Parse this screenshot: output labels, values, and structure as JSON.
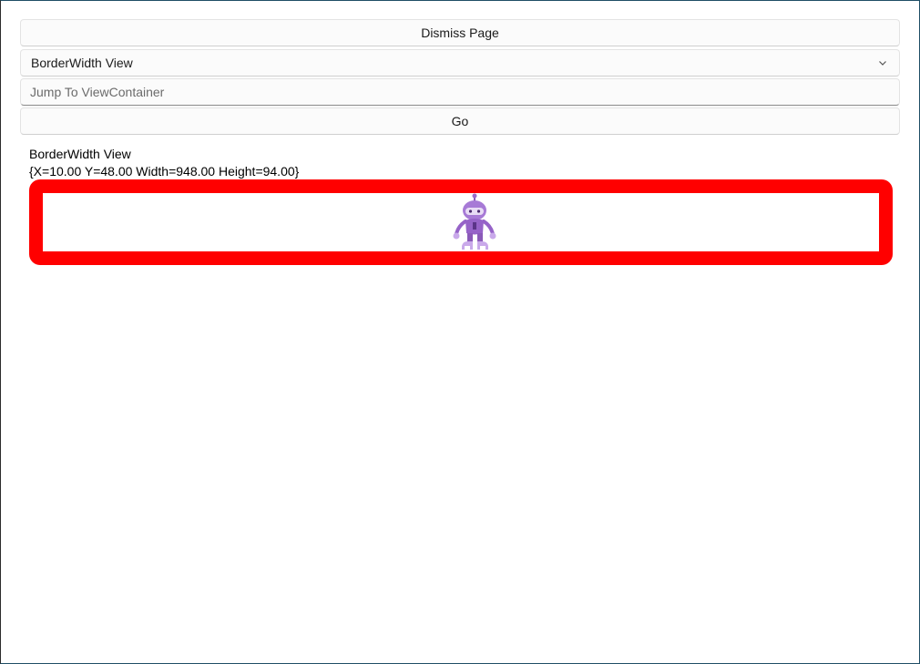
{
  "buttons": {
    "dismiss_label": "Dismiss Page",
    "go_label": "Go"
  },
  "picker": {
    "selected": "BorderWidth View",
    "icon": "chevron-down-icon"
  },
  "jump": {
    "value": "",
    "placeholder": "Jump To ViewContainer"
  },
  "view": {
    "title": "BorderWidth View",
    "bounds": "{X=10.00 Y=48.00 Width=948.00 Height=94.00}",
    "border_color": "#ff0000",
    "image": "dotnet-bot-image"
  }
}
